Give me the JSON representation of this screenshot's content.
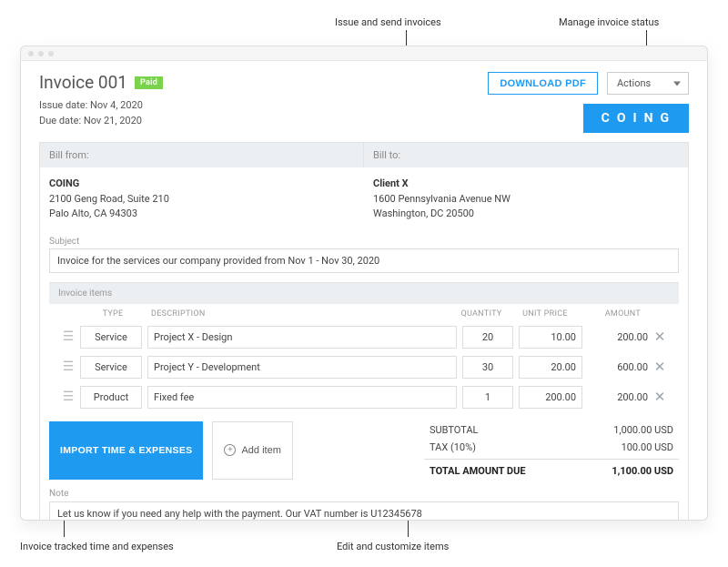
{
  "annotations": {
    "issue_send": "Issue and send invoices",
    "manage_status": "Manage invoice status",
    "invoice_tracked": "Invoice tracked time and expenses",
    "edit_items": "Edit and customize items"
  },
  "header": {
    "title": "Invoice 001",
    "badge": "Paid",
    "issue_date_label": "Issue date: Nov 4, 2020",
    "due_date_label": "Due date: Nov 21, 2020",
    "download_pdf": "DOWNLOAD PDF",
    "actions_label": "Actions",
    "brand": "COING"
  },
  "bill": {
    "from_label": "Bill from:",
    "to_label": "Bill to:",
    "from_name": "COING",
    "from_line1": "2100 Geng Road, Suite 210",
    "from_line2": "Palo Alto, CA 94303",
    "to_name": "Client X",
    "to_line1": "1600 Pennsylvania Avenue NW",
    "to_line2": "Washington, DC 20500"
  },
  "subject": {
    "label": "Subject",
    "value": "Invoice for the services our company provided from Nov 1 - Nov 30, 2020"
  },
  "items": {
    "header": "Invoice items",
    "cols": {
      "type": "TYPE",
      "desc": "DESCRIPTION",
      "qty": "QUANTITY",
      "price": "UNIT PRICE",
      "amt": "AMOUNT"
    },
    "rows": [
      {
        "type": "Service",
        "desc": "Project X - Design",
        "qty": "20",
        "price": "10.00",
        "amt": "200.00"
      },
      {
        "type": "Service",
        "desc": "Project Y - Development",
        "qty": "30",
        "price": "20.00",
        "amt": "600.00"
      },
      {
        "type": "Product",
        "desc": "Fixed fee",
        "qty": "1",
        "price": "200.00",
        "amt": "200.00"
      }
    ]
  },
  "buttons": {
    "import": "IMPORT TIME & EXPENSES",
    "add_item": "Add item"
  },
  "totals": {
    "subtotal_label": "SUBTOTAL",
    "subtotal_value": "1,000.00 USD",
    "tax_label": "TAX  (10%)",
    "tax_value": "100.00 USD",
    "total_label": "TOTAL AMOUNT DUE",
    "total_value": "1,100.00 USD"
  },
  "note": {
    "label": "Note",
    "value": "Let us know if you need any help with the payment. Our VAT number is U12345678"
  }
}
